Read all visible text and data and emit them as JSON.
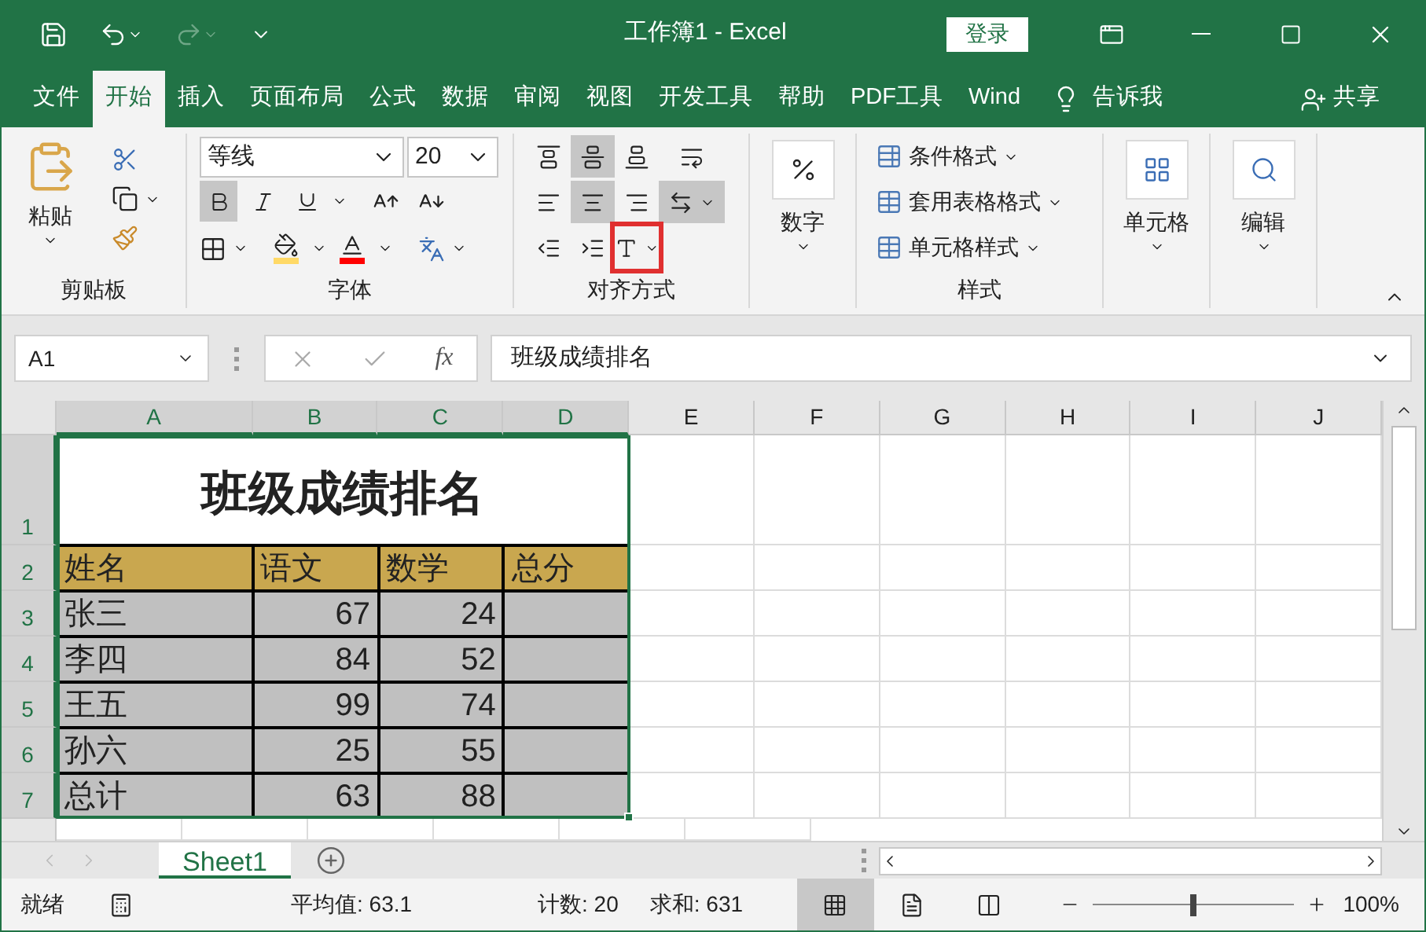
{
  "window": {
    "title": "工作簿1 - Excel",
    "login": "登录"
  },
  "ribbon_tabs": [
    {
      "label": "文件",
      "selected": false
    },
    {
      "label": "开始",
      "selected": true
    },
    {
      "label": "插入",
      "selected": false
    },
    {
      "label": "页面布局",
      "selected": false
    },
    {
      "label": "公式",
      "selected": false
    },
    {
      "label": "数据",
      "selected": false
    },
    {
      "label": "审阅",
      "selected": false
    },
    {
      "label": "视图",
      "selected": false
    },
    {
      "label": "开发工具",
      "selected": false
    },
    {
      "label": "帮助",
      "selected": false
    },
    {
      "label": "PDF工具",
      "selected": false
    },
    {
      "label": "Wind",
      "selected": false
    }
  ],
  "tell_me": "告诉我",
  "share": "共享",
  "clipboard": {
    "label": "剪贴板",
    "paste": "粘贴"
  },
  "font": {
    "label": "字体",
    "font_name": "等线",
    "font_size": "20",
    "styles": [
      {
        "kind": "bold",
        "pressed": true
      },
      {
        "kind": "italic",
        "pressed": false
      },
      {
        "kind": "underline",
        "pressed": false
      }
    ]
  },
  "alignment": {
    "label": "对齐方式",
    "buttons": [
      {
        "kind": "top",
        "pressed": false
      },
      {
        "kind": "middle",
        "pressed": true
      },
      {
        "kind": "bottom",
        "pressed": false
      },
      {
        "kind": "wrap",
        "pressed": false
      },
      {
        "kind": "left",
        "pressed": false
      },
      {
        "kind": "center",
        "pressed": true
      },
      {
        "kind": "right",
        "pressed": false
      },
      {
        "kind": "merge",
        "pressed": true
      },
      {
        "kind": "outdent",
        "pressed": false
      },
      {
        "kind": "indent",
        "pressed": false
      },
      {
        "kind": "orientation",
        "pressed": false,
        "highlighted": true
      }
    ]
  },
  "number": {
    "label": "数字"
  },
  "styles": {
    "label": "样式",
    "items": [
      "条件格式",
      "套用表格格式",
      "单元格样式"
    ]
  },
  "cells_group": {
    "label": "单元格"
  },
  "editing": {
    "label": "编辑"
  },
  "name_box": "A1",
  "fx": "fx",
  "formula": "班级成绩排名",
  "columns": [
    {
      "label": "A",
      "selected": true
    },
    {
      "label": "B",
      "selected": true
    },
    {
      "label": "C",
      "selected": true
    },
    {
      "label": "D",
      "selected": true
    },
    {
      "label": "E",
      "selected": false
    },
    {
      "label": "F",
      "selected": false
    },
    {
      "label": "G",
      "selected": false
    },
    {
      "label": "H",
      "selected": false
    },
    {
      "label": "I",
      "selected": false
    },
    {
      "label": "J",
      "selected": false
    }
  ],
  "title_row": {
    "row": "1",
    "text": "班级成绩排名",
    "selected": true
  },
  "header_row": {
    "row": "2",
    "selected": true,
    "cells": [
      "姓名",
      "语文",
      "数学",
      "总分"
    ]
  },
  "rows": [
    {
      "row": "3",
      "selected": true,
      "cells": [
        "张三",
        "67",
        "24"
      ]
    },
    {
      "row": "4",
      "selected": true,
      "cells": [
        "李四",
        "84",
        "52"
      ]
    },
    {
      "row": "5",
      "selected": true,
      "cells": [
        "王五",
        "99",
        "74"
      ]
    },
    {
      "row": "6",
      "selected": true,
      "cells": [
        "孙六",
        "25",
        "55"
      ]
    },
    {
      "row": "7",
      "selected": true,
      "cells": [
        "总计",
        "63",
        "88"
      ]
    }
  ],
  "sheets": [
    {
      "label": "Sheet1",
      "selected": true
    }
  ],
  "status_bar": {
    "ready": "就绪",
    "average": "平均值: 63.1",
    "count": "计数: 20",
    "sum": "求和: 631",
    "views": [
      {
        "kind": "normal",
        "selected": true
      },
      {
        "kind": "page_layout",
        "selected": false
      },
      {
        "kind": "page_break",
        "selected": false
      }
    ],
    "zoom": {
      "level": 0.5,
      "reading": "100%"
    }
  }
}
